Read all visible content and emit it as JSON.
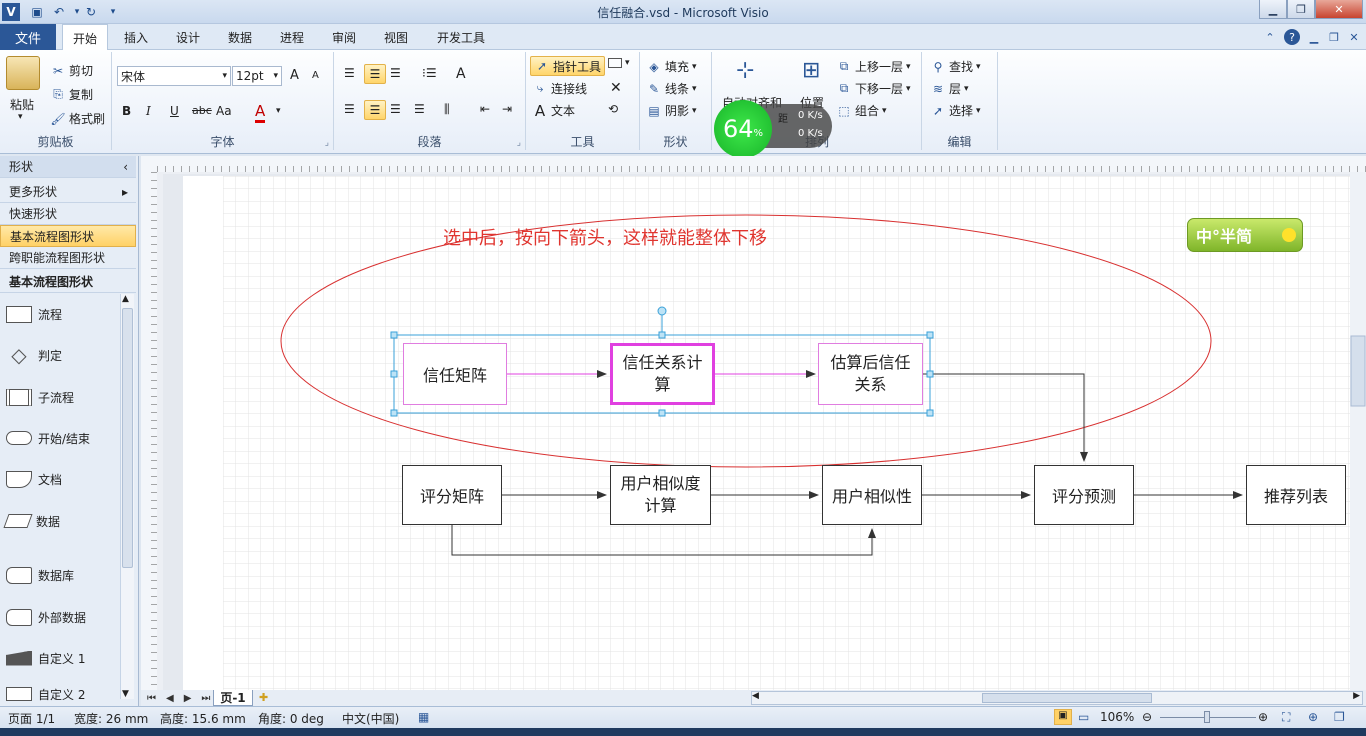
{
  "window": {
    "title": "信任融合.vsd - Microsoft Visio",
    "min": "▁",
    "max": "❐",
    "close": "✕"
  },
  "menu": {
    "file": "文件",
    "tabs": [
      "开始",
      "插入",
      "设计",
      "数据",
      "进程",
      "审阅",
      "视图",
      "开发工具"
    ]
  },
  "ribbon": {
    "clipboard": {
      "label": "剪贴板",
      "paste": "粘贴",
      "cut": "剪切",
      "copy": "复制",
      "format_painter": "格式刷"
    },
    "font": {
      "label": "字体",
      "name": "宋体",
      "size": "12pt",
      "bold": "B",
      "italic": "I",
      "underline": "U",
      "strike": "abc",
      "case": "Aa",
      "color": "A",
      "grow": "A",
      "shrink": "A"
    },
    "paragraph": {
      "label": "段落"
    },
    "tools": {
      "label": "工具",
      "pointer": "指针工具",
      "connector": "连接线",
      "text": "文本"
    },
    "shape": {
      "label": "形状",
      "fill": "填充",
      "line": "线条",
      "shadow": "阴影"
    },
    "arrange": {
      "label": "排列",
      "auto_align": "自动对齐和",
      "position": "位置",
      "bring_forward": "上移一层",
      "send_backward": "下移一层",
      "group": "组合",
      "partial": "距"
    },
    "editing": {
      "label": "编辑",
      "find": "查找",
      "layers": "层",
      "select": "选择"
    }
  },
  "speed_widget": {
    "percent": "64",
    "unit": "%",
    "up": "0 K/s",
    "down": "0 K/s"
  },
  "sidebar": {
    "header": "形状",
    "rows": [
      "更多形状",
      "快速形状",
      "基本流程图形状",
      "跨职能流程图形状"
    ],
    "stencil_title": "基本流程图形状",
    "shapes": [
      "流程",
      "判定",
      "子流程",
      "开始/结束",
      "文档",
      "数据",
      "数据库",
      "外部数据",
      "自定义 1",
      "自定义 2"
    ]
  },
  "diagram": {
    "annotation": "选中后，按向下箭头，这样就能整体下移",
    "top_row": [
      "信任矩阵",
      "信任关系计算",
      "估算后信任关系"
    ],
    "bottom_row": [
      "评分矩阵",
      "用户相似度计算",
      "用户相似性",
      "评分预测",
      "推荐列表"
    ]
  },
  "ime": {
    "text": "中°半简"
  },
  "page_tabs": {
    "page": "页-1"
  },
  "status": {
    "page": "页面 1/1",
    "width": "宽度: 26 mm",
    "height": "高度: 15.6 mm",
    "angle": "角度: 0 deg",
    "lang": "中文(中国)",
    "zoom": "106%"
  },
  "colors": {
    "accent": "#2b5797",
    "annotation": "#e0352f",
    "selection": "#e040e0",
    "ellipse": "#d83030"
  }
}
